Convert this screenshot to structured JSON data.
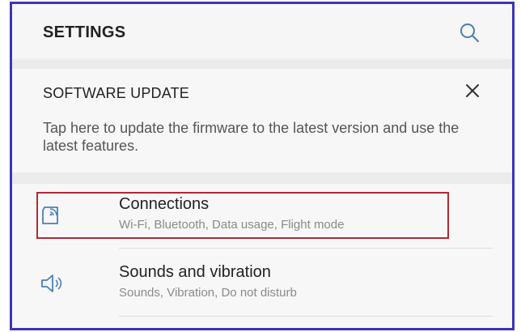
{
  "header": {
    "title": "SETTINGS",
    "search_icon": "search-icon"
  },
  "update_card": {
    "title": "SOFTWARE UPDATE",
    "body": "Tap here to update the firmware to the latest version and use the latest features.",
    "close_icon": "close-icon"
  },
  "list": {
    "items": [
      {
        "icon": "connections-icon",
        "title": "Connections",
        "subtitle": "Wi-Fi, Bluetooth, Data usage, Flight mode"
      },
      {
        "icon": "speaker-icon",
        "title": "Sounds and vibration",
        "subtitle": "Sounds, Vibration, Do not disturb"
      }
    ]
  },
  "colors": {
    "frame_border": "#3a36b8",
    "highlight_border": "#b02a37",
    "accent_icon": "#4a7fb5"
  }
}
